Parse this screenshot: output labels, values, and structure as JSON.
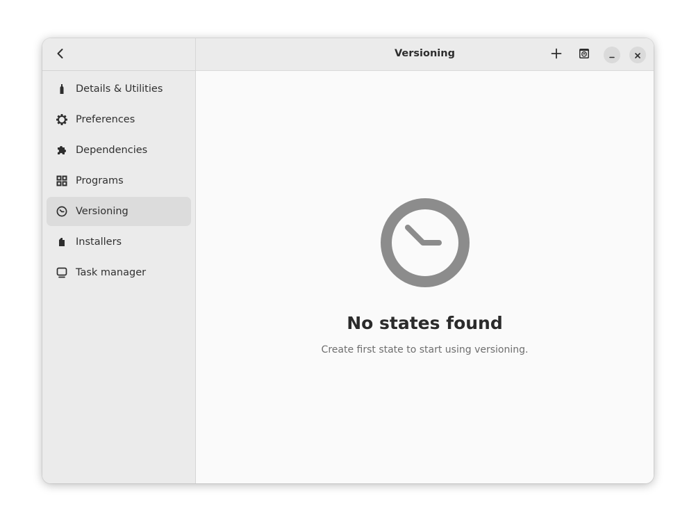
{
  "header": {
    "title": "Versioning",
    "back_icon": "back-arrow-icon",
    "add_icon": "plus-icon",
    "snapshot_icon": "snapshot-icon",
    "minimize_icon": "minimize-icon",
    "close_icon": "close-icon"
  },
  "sidebar": {
    "items": [
      {
        "label": "Details & Utilities",
        "icon": "bottle-icon",
        "active": false
      },
      {
        "label": "Preferences",
        "icon": "gear-icon",
        "active": false
      },
      {
        "label": "Dependencies",
        "icon": "puzzle-icon",
        "active": false
      },
      {
        "label": "Programs",
        "icon": "grid-icon",
        "active": false
      },
      {
        "label": "Versioning",
        "icon": "clock-icon",
        "active": true
      },
      {
        "label": "Installers",
        "icon": "package-icon",
        "active": false
      },
      {
        "label": "Task manager",
        "icon": "monitor-icon",
        "active": false
      }
    ]
  },
  "empty_state": {
    "icon": "clock-icon",
    "title": "No states found",
    "description": "Create first state to start using versioning."
  },
  "colors": {
    "sidebar_bg": "#ebebeb",
    "active_item_bg": "#dcdcdc",
    "content_bg": "#fafafa",
    "empty_icon": "#8c8c8c"
  }
}
